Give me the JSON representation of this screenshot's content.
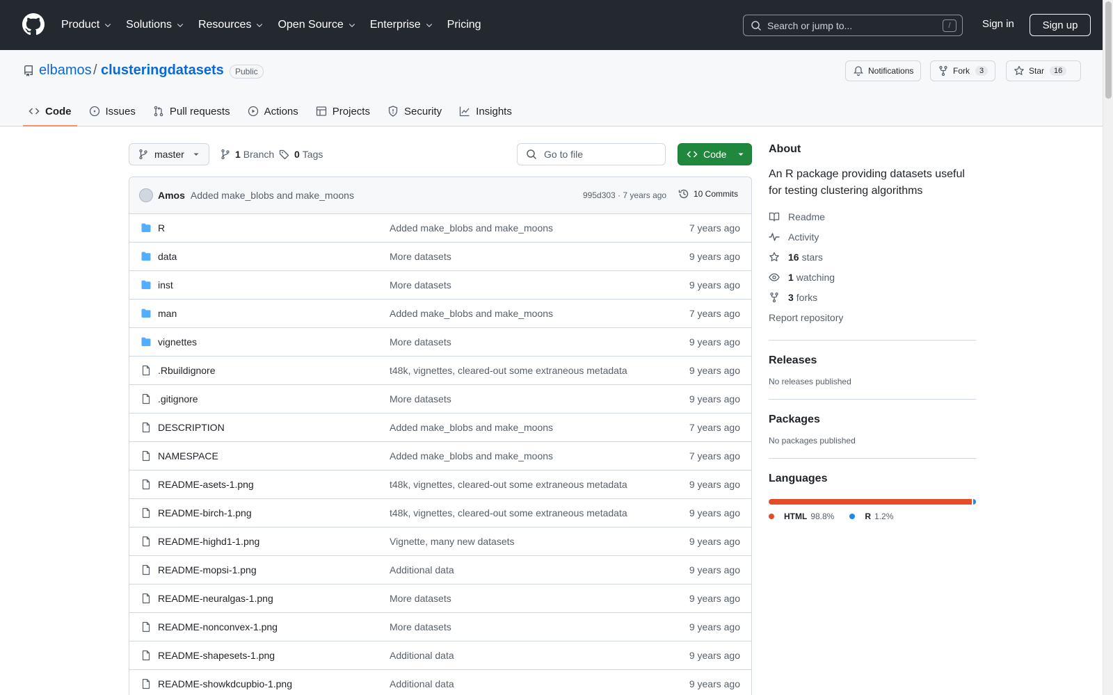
{
  "top_nav": {
    "items": [
      {
        "label": "Product",
        "dropdown": true
      },
      {
        "label": "Solutions",
        "dropdown": true
      },
      {
        "label": "Resources",
        "dropdown": true
      },
      {
        "label": "Open Source",
        "dropdown": true
      },
      {
        "label": "Enterprise",
        "dropdown": true
      },
      {
        "label": "Pricing",
        "dropdown": false
      }
    ],
    "search_placeholder": "Search or jump to...",
    "search_shortcut": "/",
    "sign_in": "Sign in",
    "sign_up": "Sign up"
  },
  "repo": {
    "owner": "elbamos",
    "separator": "/",
    "name": "clusteringdatasets",
    "visibility": "Public",
    "notifications_label": "Notifications",
    "fork_label": "Fork",
    "fork_count": "3",
    "star_label": "Star",
    "star_count": "16",
    "tabs": [
      {
        "label": "Code",
        "icon": "code-icon",
        "active": true
      },
      {
        "label": "Issues",
        "icon": "issue-icon",
        "active": false
      },
      {
        "label": "Pull requests",
        "icon": "pull-request-icon",
        "active": false
      },
      {
        "label": "Actions",
        "icon": "play-icon",
        "active": false
      },
      {
        "label": "Projects",
        "icon": "table-icon",
        "active": false
      },
      {
        "label": "Security",
        "icon": "shield-icon",
        "active": false
      },
      {
        "label": "Insights",
        "icon": "graph-icon",
        "active": false
      }
    ]
  },
  "toolbar": {
    "branch": "master",
    "branch_count": "1",
    "branch_label": "Branch",
    "tag_count": "0",
    "tag_label": "Tags",
    "goto_placeholder": "Go to file",
    "code_button": "Code"
  },
  "latest_commit": {
    "author": "Amos",
    "message": "Added make_blobs and make_moons",
    "meta": "995d303 · 7 years ago",
    "commits_label": "10 Commits"
  },
  "files": [
    {
      "name": "R",
      "type": "dir",
      "message": "Added make_blobs and make_moons",
      "age": "7 years ago"
    },
    {
      "name": "data",
      "type": "dir",
      "message": "More datasets",
      "age": "9 years ago"
    },
    {
      "name": "inst",
      "type": "dir",
      "message": "More datasets",
      "age": "9 years ago"
    },
    {
      "name": "man",
      "type": "dir",
      "message": "Added make_blobs and make_moons",
      "age": "7 years ago"
    },
    {
      "name": "vignettes",
      "type": "dir",
      "message": "More datasets",
      "age": "9 years ago"
    },
    {
      "name": ".Rbuildignore",
      "type": "file",
      "message": "t48k, vignettes, cleared-out some extraneous metadata",
      "age": "9 years ago"
    },
    {
      "name": ".gitignore",
      "type": "file",
      "message": "More datasets",
      "age": "9 years ago"
    },
    {
      "name": "DESCRIPTION",
      "type": "file",
      "message": "Added make_blobs and make_moons",
      "age": "7 years ago"
    },
    {
      "name": "NAMESPACE",
      "type": "file",
      "message": "Added make_blobs and make_moons",
      "age": "7 years ago"
    },
    {
      "name": "README-asets-1.png",
      "type": "file",
      "message": "t48k, vignettes, cleared-out some extraneous metadata",
      "age": "9 years ago"
    },
    {
      "name": "README-birch-1.png",
      "type": "file",
      "message": "t48k, vignettes, cleared-out some extraneous metadata",
      "age": "9 years ago"
    },
    {
      "name": "README-highd1-1.png",
      "type": "file",
      "message": "Vignette, many new datasets",
      "age": "9 years ago"
    },
    {
      "name": "README-mopsi-1.png",
      "type": "file",
      "message": "Additional data",
      "age": "9 years ago"
    },
    {
      "name": "README-neuralgas-1.png",
      "type": "file",
      "message": "More datasets",
      "age": "9 years ago"
    },
    {
      "name": "README-nonconvex-1.png",
      "type": "file",
      "message": "More datasets",
      "age": "9 years ago"
    },
    {
      "name": "README-shapesets-1.png",
      "type": "file",
      "message": "Additional data",
      "age": "9 years ago"
    },
    {
      "name": "README-showkdcupbio-1.png",
      "type": "file",
      "message": "Additional data",
      "age": "9 years ago"
    }
  ],
  "about": {
    "heading": "About",
    "description": "An R package providing datasets useful for testing clustering algorithms",
    "links": [
      {
        "icon": "book-icon",
        "bold": "",
        "label": "Readme"
      },
      {
        "icon": "pulse-icon",
        "bold": "",
        "label": "Activity"
      },
      {
        "icon": "star-icon",
        "bold": "16",
        "label": "stars"
      },
      {
        "icon": "eye-icon",
        "bold": "1",
        "label": "watching"
      },
      {
        "icon": "fork-icon",
        "bold": "3",
        "label": "forks"
      }
    ],
    "report": "Report repository"
  },
  "releases": {
    "heading": "Releases",
    "subtitle": "No releases published"
  },
  "packages": {
    "heading": "Packages",
    "subtitle": "No packages published"
  },
  "languages": {
    "heading": "Languages",
    "items": [
      {
        "name": "HTML",
        "percent": "98.8%",
        "share": 98.8,
        "color": "#e34c26"
      },
      {
        "name": "R",
        "percent": "1.2%",
        "share": 1.2,
        "color": "#198ce7"
      }
    ]
  },
  "colors": {
    "header_bg": "#24292f",
    "link": "#0969da",
    "primary_button": "#1f883d",
    "active_tab_underline": "#fd8c73",
    "folder": "#54aeff"
  }
}
